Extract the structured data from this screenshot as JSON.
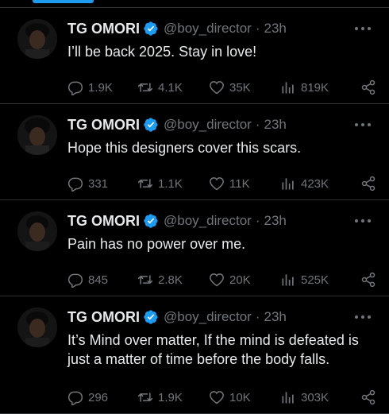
{
  "tweets": [
    {
      "name": "TG OMORI",
      "handle": "@boy_director",
      "dot": "·",
      "time": "23h",
      "text": "I’ll be back 2025. Stay in love!",
      "replies": "1.9K",
      "retweets": "4.1K",
      "likes": "35K",
      "views": "819K"
    },
    {
      "name": "TG OMORI",
      "handle": "@boy_director",
      "dot": "·",
      "time": "23h",
      "text": "Hope this designers cover this scars.",
      "replies": "331",
      "retweets": "1.1K",
      "likes": "11K",
      "views": "423K"
    },
    {
      "name": "TG OMORI",
      "handle": "@boy_director",
      "dot": "·",
      "time": "23h",
      "text": "Pain has no power over me.",
      "replies": "845",
      "retweets": "2.8K",
      "likes": "20K",
      "views": "525K"
    },
    {
      "name": "TG OMORI",
      "handle": "@boy_director",
      "dot": "·",
      "time": "23h",
      "text": "It’s Mind over matter, If the mind is defeated is just a matter of time before the body falls.",
      "replies": "296",
      "retweets": "1.9K",
      "likes": "10K",
      "views": "303K"
    }
  ],
  "colors": {
    "accent": "#1d9bf0",
    "muted": "#71767b",
    "text": "#e7e9ea",
    "divider": "#2f3336",
    "background": "#000000"
  },
  "icons": [
    "verified-badge-icon",
    "more-icon",
    "reply-icon",
    "retweet-icon",
    "like-icon",
    "views-icon",
    "share-icon"
  ]
}
